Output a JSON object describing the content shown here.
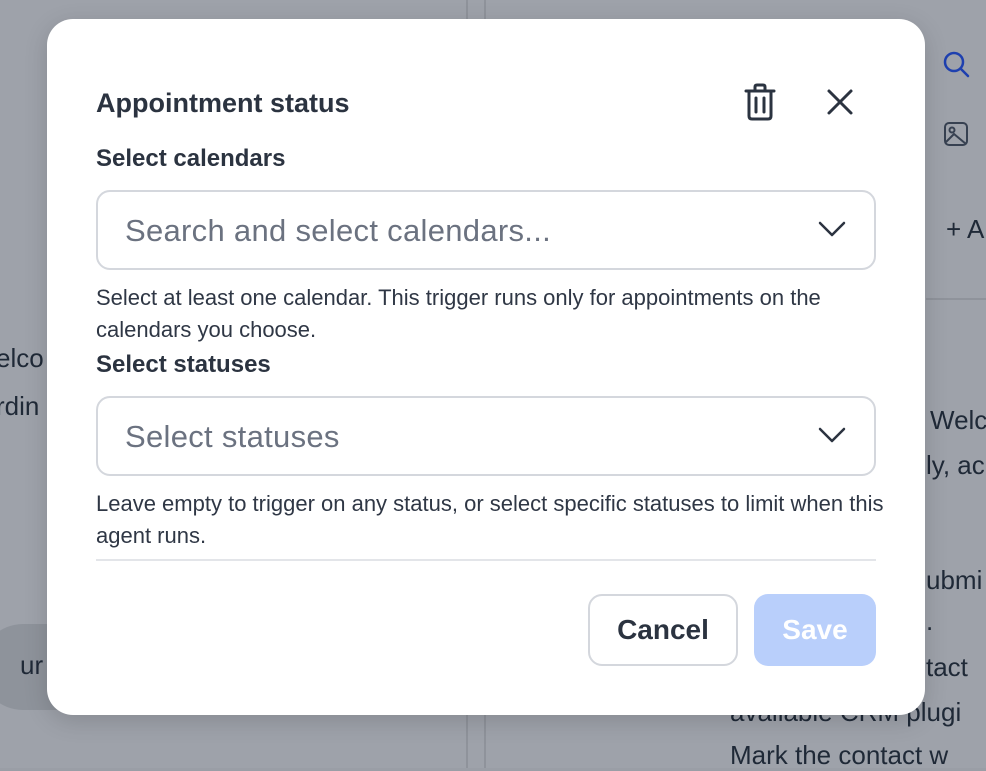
{
  "background": {
    "left_fragments": [
      "elco",
      "rdin"
    ],
    "pill_text": "ur",
    "right_fragments": [
      "Welc",
      "ly, ac",
      "ubmi",
      ".",
      "tact",
      "avallable CRM plugi",
      "Mark the contact w"
    ],
    "add_label": "+ A"
  },
  "modal": {
    "title": "Appointment status",
    "icons": {
      "delete": "trash-icon",
      "close": "close-icon"
    },
    "calendars": {
      "label": "Select calendars",
      "placeholder": "Search and select calendars...",
      "help": "Select at least one calendar. This trigger runs only for appointments on the calendars you choose."
    },
    "statuses": {
      "label": "Select statuses",
      "placeholder": "Select statuses",
      "help": "Leave empty to trigger on any status, or select specific statuses to limit when this agent runs."
    },
    "buttons": {
      "cancel": "Cancel",
      "save": "Save"
    }
  },
  "colors": {
    "overlay": "#9ea2aa",
    "text_dark": "#2b3340",
    "placeholder": "#6b7280",
    "border": "#d4d7dd",
    "save_disabled": "#b9cffb",
    "accent_blue": "#1e40af"
  }
}
